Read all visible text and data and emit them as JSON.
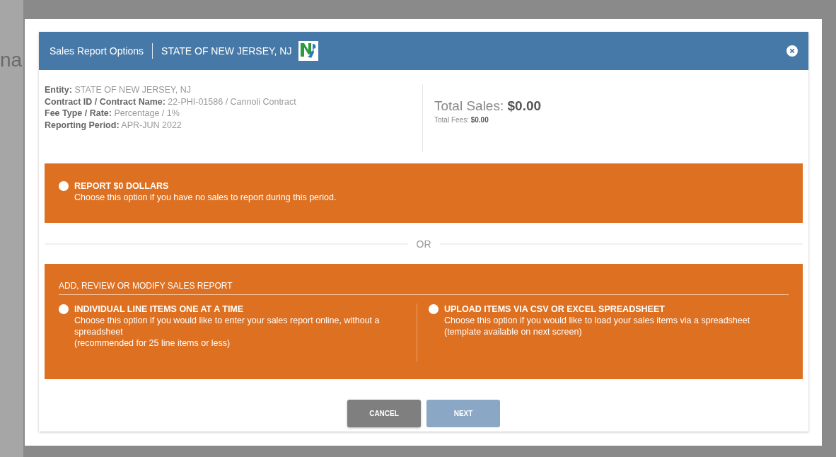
{
  "background": {
    "title_fragment": "na"
  },
  "dialog": {
    "title": "Sales Report Options",
    "entity": "STATE OF NEW JERSEY, NJ"
  },
  "details": [
    {
      "label": "Entity:",
      "value": "STATE OF NEW JERSEY, NJ"
    },
    {
      "label": "Contract ID / Contract Name:",
      "value": "22-PHI-01586 / Cannoli Contract"
    },
    {
      "label": "Fee Type / Rate:",
      "value": "Percentage / 1%"
    },
    {
      "label": "Reporting Period:",
      "value": "APR-JUN 2022"
    }
  ],
  "totals": {
    "sales_label": "Total Sales:",
    "sales_value": "$0.00",
    "fees_label": "Total Fees:",
    "fees_value": "$0.00"
  },
  "zero_option": {
    "title": "REPORT $0 DOLLARS",
    "description": [
      "Choose this option if you have no sales to report during this period."
    ],
    "selected": false
  },
  "separator": "OR",
  "report_section": {
    "heading": "ADD, REVIEW OR MODIFY SALES REPORT",
    "options": [
      {
        "title": "INDIVIDUAL LINE ITEMS ONE AT A TIME",
        "description": [
          "Choose this option if you would like to enter your sales report online, without a spreadsheet",
          "(recommended for 25 line items or less)"
        ],
        "selected": false
      },
      {
        "title": "UPLOAD ITEMS VIA CSV OR EXCEL SPREADSHEET",
        "description": [
          "Choose this option if you would like to load your sales items via a spreadsheet",
          "(template available on next screen)"
        ],
        "selected": false
      }
    ]
  },
  "buttons": [
    {
      "label": "CANCEL",
      "kind": "secondary",
      "disabled": false
    },
    {
      "label": "NEXT",
      "kind": "primary",
      "disabled": true
    }
  ]
}
